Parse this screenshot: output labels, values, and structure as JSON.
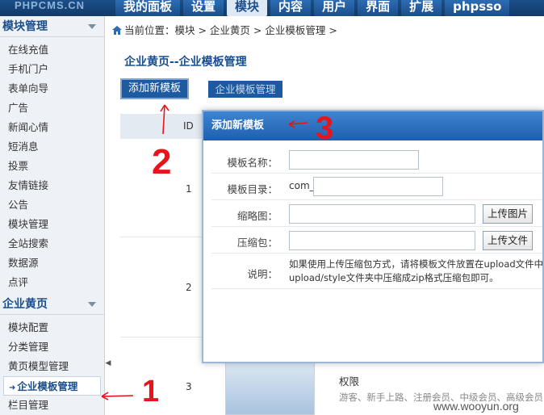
{
  "logo": "PHPCMS.CN",
  "nav": {
    "tabs": [
      "我的面板",
      "设置",
      "模块",
      "内容",
      "用户",
      "界面",
      "扩展",
      "phpsso"
    ],
    "active_index": 2
  },
  "sidebar": {
    "sections": [
      {
        "title": "模块管理",
        "items": [
          "在线充值",
          "手机门户",
          "表单向导",
          "广告",
          "新闻心情",
          "短消息",
          "投票",
          "友情链接",
          "公告",
          "模块管理",
          "全站搜索",
          "数据源",
          "点评"
        ]
      },
      {
        "title": "企业黄页",
        "items": [
          "模块配置",
          "分类管理",
          "黄页模型管理",
          "企业模板管理",
          "栏目管理"
        ]
      }
    ],
    "active_item": "企业模板管理"
  },
  "breadcrumb": "当前位置：模块 > 企业黄页 > 企业模板管理 >",
  "page": {
    "title": "企业黄页--企业模板管理",
    "add_button": "添加新模板",
    "manage_button": "企业模板管理"
  },
  "table": {
    "id_header": "ID",
    "row_ids": [
      "1",
      "2",
      "3"
    ],
    "bottom_row": {
      "text1": "权限",
      "text2": "游客、新手上路、注册会员、中级会员、高级会员"
    }
  },
  "dialog": {
    "title": "添加新模板",
    "fields": {
      "name_label": "模板名称：",
      "name_value": "",
      "dir_label": "模板目录：",
      "dir_prefix": "com_",
      "dir_value": "",
      "thumb_label": "缩略图：",
      "thumb_value": "",
      "thumb_button": "上传图片",
      "zip_label": "压缩包：",
      "zip_value": "",
      "zip_button": "上传文件",
      "desc_label": "说明：",
      "desc_line1": "如果使用上传压缩包方式，请将模板文件放置在upload文件中",
      "desc_line2": "upload/style文件夹中压缩成zip格式压缩包即可。"
    }
  },
  "annotations": [
    "1",
    "2",
    "3"
  ],
  "watermark": "www.wooyun.org",
  "colors": {
    "brand_blue": "#1d5aa0",
    "annotation_red": "#e8141c"
  }
}
